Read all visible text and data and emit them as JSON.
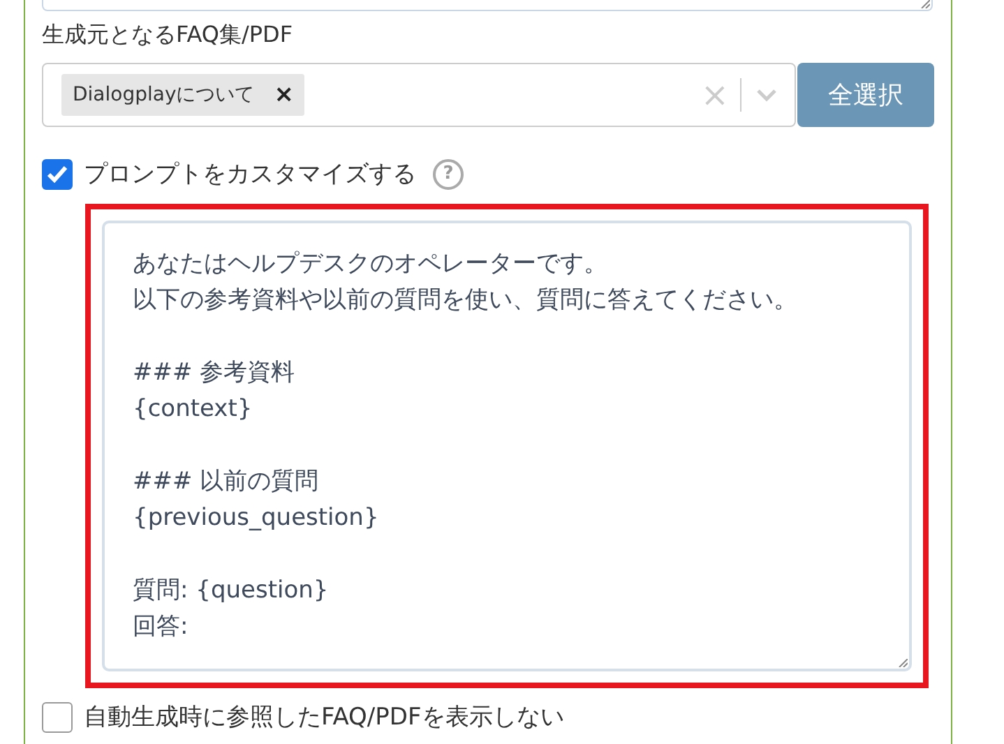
{
  "source_label": "生成元となるFAQ集/PDF",
  "source_select": {
    "tags": [
      {
        "label": "Dialogplayについて",
        "remove": "×"
      }
    ],
    "clear": "×"
  },
  "select_all_button": "全選択",
  "customize_prompt": {
    "label": "プロンプトをカスタマイズする",
    "checked": true,
    "help": "?"
  },
  "prompt_paragraphs": [
    [
      "あなたはヘルプデスクのオペレーターです。",
      "以下の参考資料や以前の質問を使い、質問に答えてください。"
    ],
    [
      "### 参考資料",
      "{context}"
    ],
    [
      "### 以前の質問",
      "{previous_question}"
    ],
    [
      "質問: {question}",
      "回答:"
    ]
  ],
  "prompt_highlighted": true,
  "hide_references": {
    "label": "自動生成時に参照したFAQ/PDFを表示しない",
    "checked": false
  }
}
